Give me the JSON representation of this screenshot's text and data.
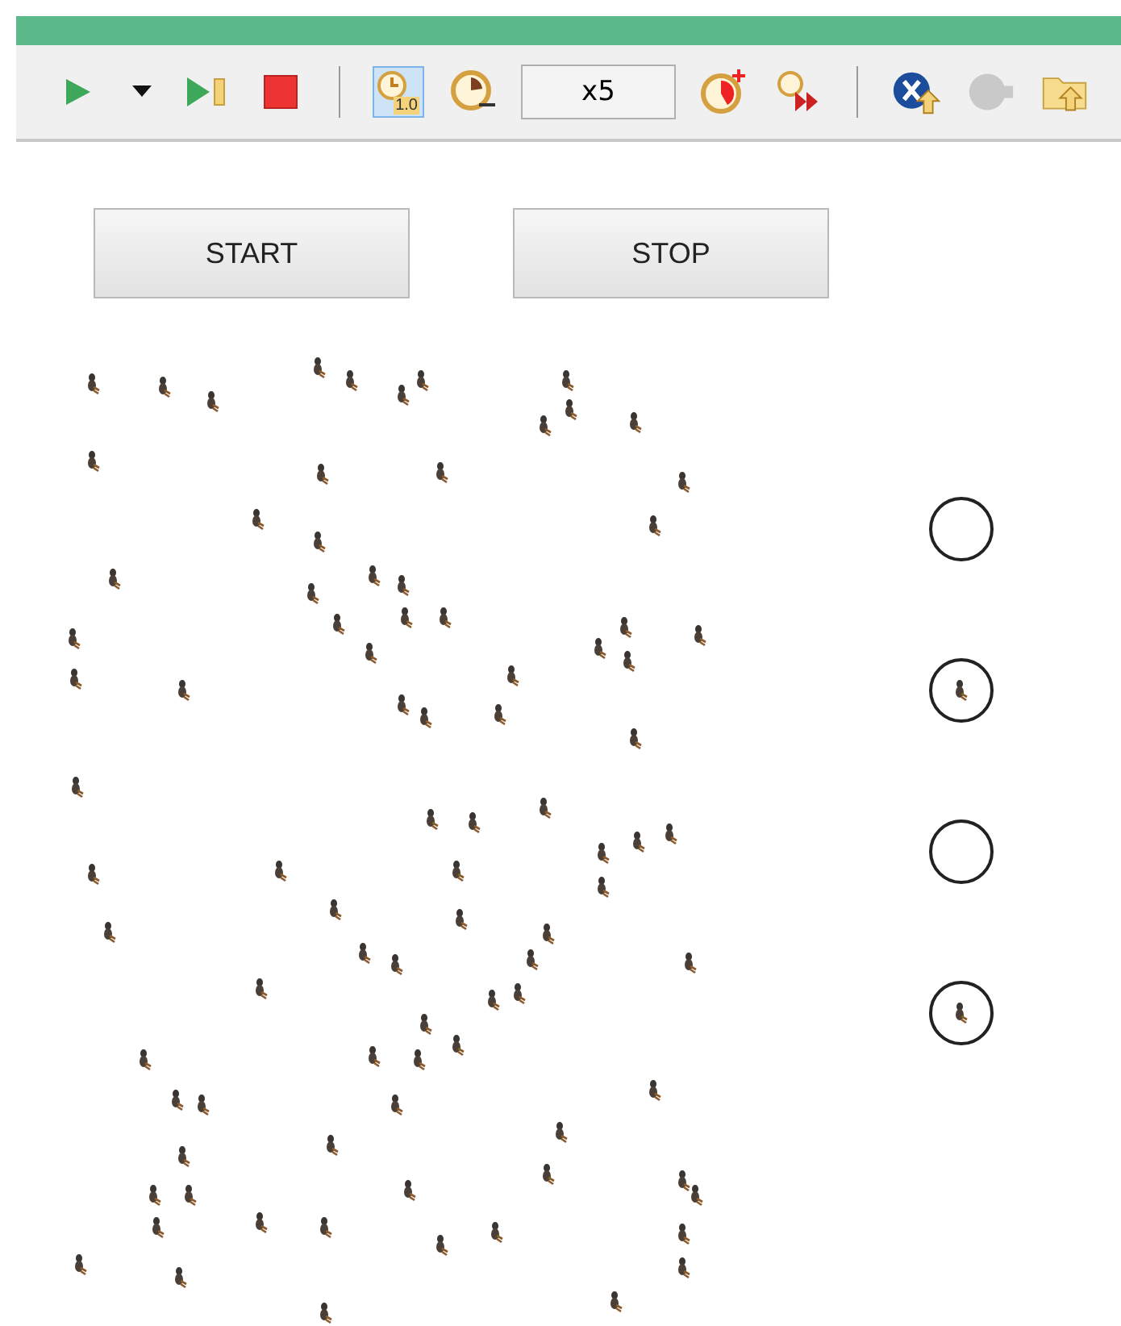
{
  "toolbar": {
    "items": [
      {
        "kind": "run",
        "selected": false,
        "disabled": false
      },
      {
        "kind": "dropdown",
        "selected": false,
        "disabled": false
      },
      {
        "kind": "step",
        "selected": false,
        "disabled": false
      },
      {
        "kind": "stop",
        "selected": false,
        "disabled": false
      },
      {
        "kind": "separator"
      },
      {
        "kind": "realtime",
        "label": "1.0",
        "selected": true,
        "disabled": false
      },
      {
        "kind": "slower",
        "selected": false,
        "disabled": false
      },
      {
        "kind": "field",
        "value": "x5"
      },
      {
        "kind": "faster",
        "selected": false,
        "disabled": false
      },
      {
        "kind": "fastest",
        "selected": false,
        "disabled": false
      },
      {
        "kind": "separator"
      },
      {
        "kind": "export",
        "selected": false,
        "disabled": false
      },
      {
        "kind": "plugin",
        "selected": false,
        "disabled": true
      },
      {
        "kind": "folder",
        "selected": false,
        "disabled": false
      }
    ]
  },
  "buttons": [
    {
      "label": "START"
    },
    {
      "label": "STOP"
    }
  ],
  "slots": [
    {
      "occupied": false
    },
    {
      "occupied": true
    },
    {
      "occupied": false
    },
    {
      "occupied": true
    }
  ]
}
